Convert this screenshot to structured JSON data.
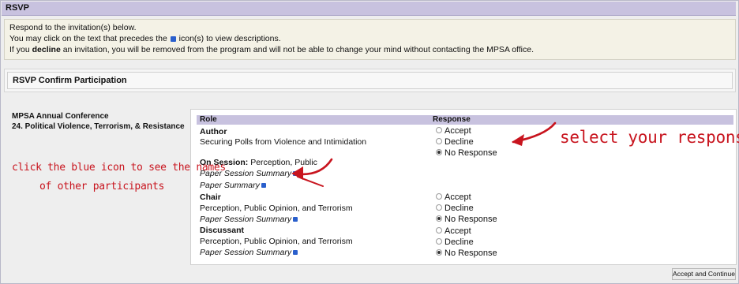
{
  "window": {
    "title": "RSVP"
  },
  "intro": {
    "line1": "Respond to the invitation(s) below.",
    "line2_before": "You may click on the text that precedes the",
    "line2_after": "icon(s) to view descriptions.",
    "line3_before": "If you",
    "line3_bold": "decline",
    "line3_after": "an invitation, you will be removed from the program and will not be able to change your mind without contacting the MPSA office."
  },
  "section": {
    "title": "RSVP Confirm Participation"
  },
  "event": {
    "name": "MPSA Annual Conference",
    "session": "24. Political Violence, Terrorism, & Resistance"
  },
  "table": {
    "headers": {
      "role": "Role",
      "response": "Response"
    },
    "groups": [
      {
        "role": "Author",
        "title": "Securing Polls from Violence and Intimidation",
        "on_session_label": "On Session:",
        "on_session_value": "Perception, Public",
        "link1": "Paper Session Summary",
        "link2": "Paper Summary",
        "options": [
          "Accept",
          "Decline",
          "No Response"
        ],
        "selected": "No Response"
      },
      {
        "role": "Chair",
        "title": "Perception, Public Opinion, and Terrorism",
        "link1": "Paper Session Summary",
        "options": [
          "Accept",
          "Decline",
          "No Response"
        ],
        "selected": "No Response"
      },
      {
        "role": "Discussant",
        "title": "Perception, Public Opinion, and Terrorism",
        "link1": "Paper Session Summary",
        "options": [
          "Accept",
          "Decline",
          "No Response"
        ],
        "selected": "No Response"
      }
    ]
  },
  "annotations": {
    "select": "select your response",
    "blue_line1": "click the blue icon to see the names",
    "blue_line2": "of other participants"
  },
  "buttons": {
    "accept_continue": "Accept and Continue"
  },
  "colors": {
    "header_bg": "#c8c2df",
    "annotation": "#c8141e",
    "info_icon": "#2a5fcc"
  }
}
